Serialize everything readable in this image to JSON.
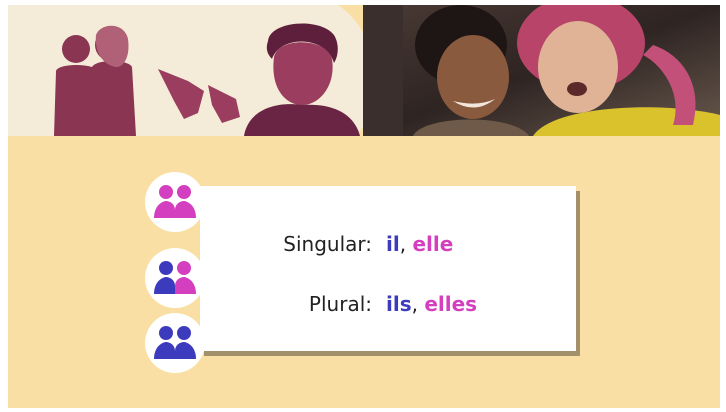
{
  "rows": [
    {
      "label": "Singular:",
      "word1": "il",
      "separator": ",",
      "word2": "elle"
    },
    {
      "label": "Plural:",
      "word1": "ils",
      "separator": ",",
      "word2": "elles"
    }
  ],
  "icons": [
    "two-women-group-icon",
    "mixed-group-icon",
    "two-men-group-icon"
  ],
  "colors": {
    "background": "#f9dfa4",
    "masculine_blue": "#3d3bbd",
    "feminine_pink": "#d43fbf",
    "illustration_maroon": "#8a3552"
  }
}
